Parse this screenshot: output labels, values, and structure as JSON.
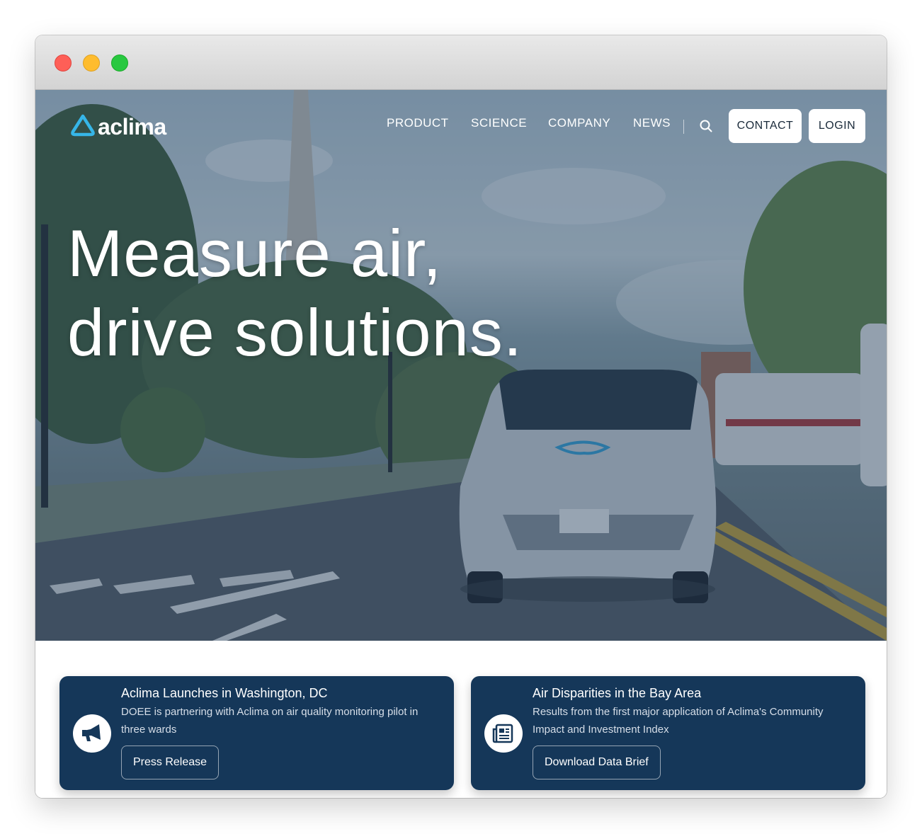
{
  "site": {
    "logo_text": "aclima",
    "logo_icon": "aclima-cloud-icon",
    "brand_color": "#36b6e8"
  },
  "nav": {
    "links": [
      "PRODUCT",
      "SCIENCE",
      "COMPANY",
      "NEWS"
    ],
    "search_icon": "search-icon",
    "contact_label": "CONTACT",
    "login_label": "LOGIN"
  },
  "hero": {
    "headline_line1": "Measure air,",
    "headline_line2": "drive solutions."
  },
  "cards": [
    {
      "icon": "megaphone-icon",
      "title": "Aclima Launches in Washington, DC",
      "description": "DOEE is partnering with Aclima on air quality monitoring pilot in three wards",
      "button_label": "Press Release"
    },
    {
      "icon": "newspaper-icon",
      "title": "Air Disparities in the Bay Area",
      "description": "Results from the first major application of Aclima's Community Impact and Investment Index",
      "button_label": "Download Data Brief"
    }
  ],
  "colors": {
    "card_background": "#153759",
    "hero_overlay": "#1a395a"
  }
}
